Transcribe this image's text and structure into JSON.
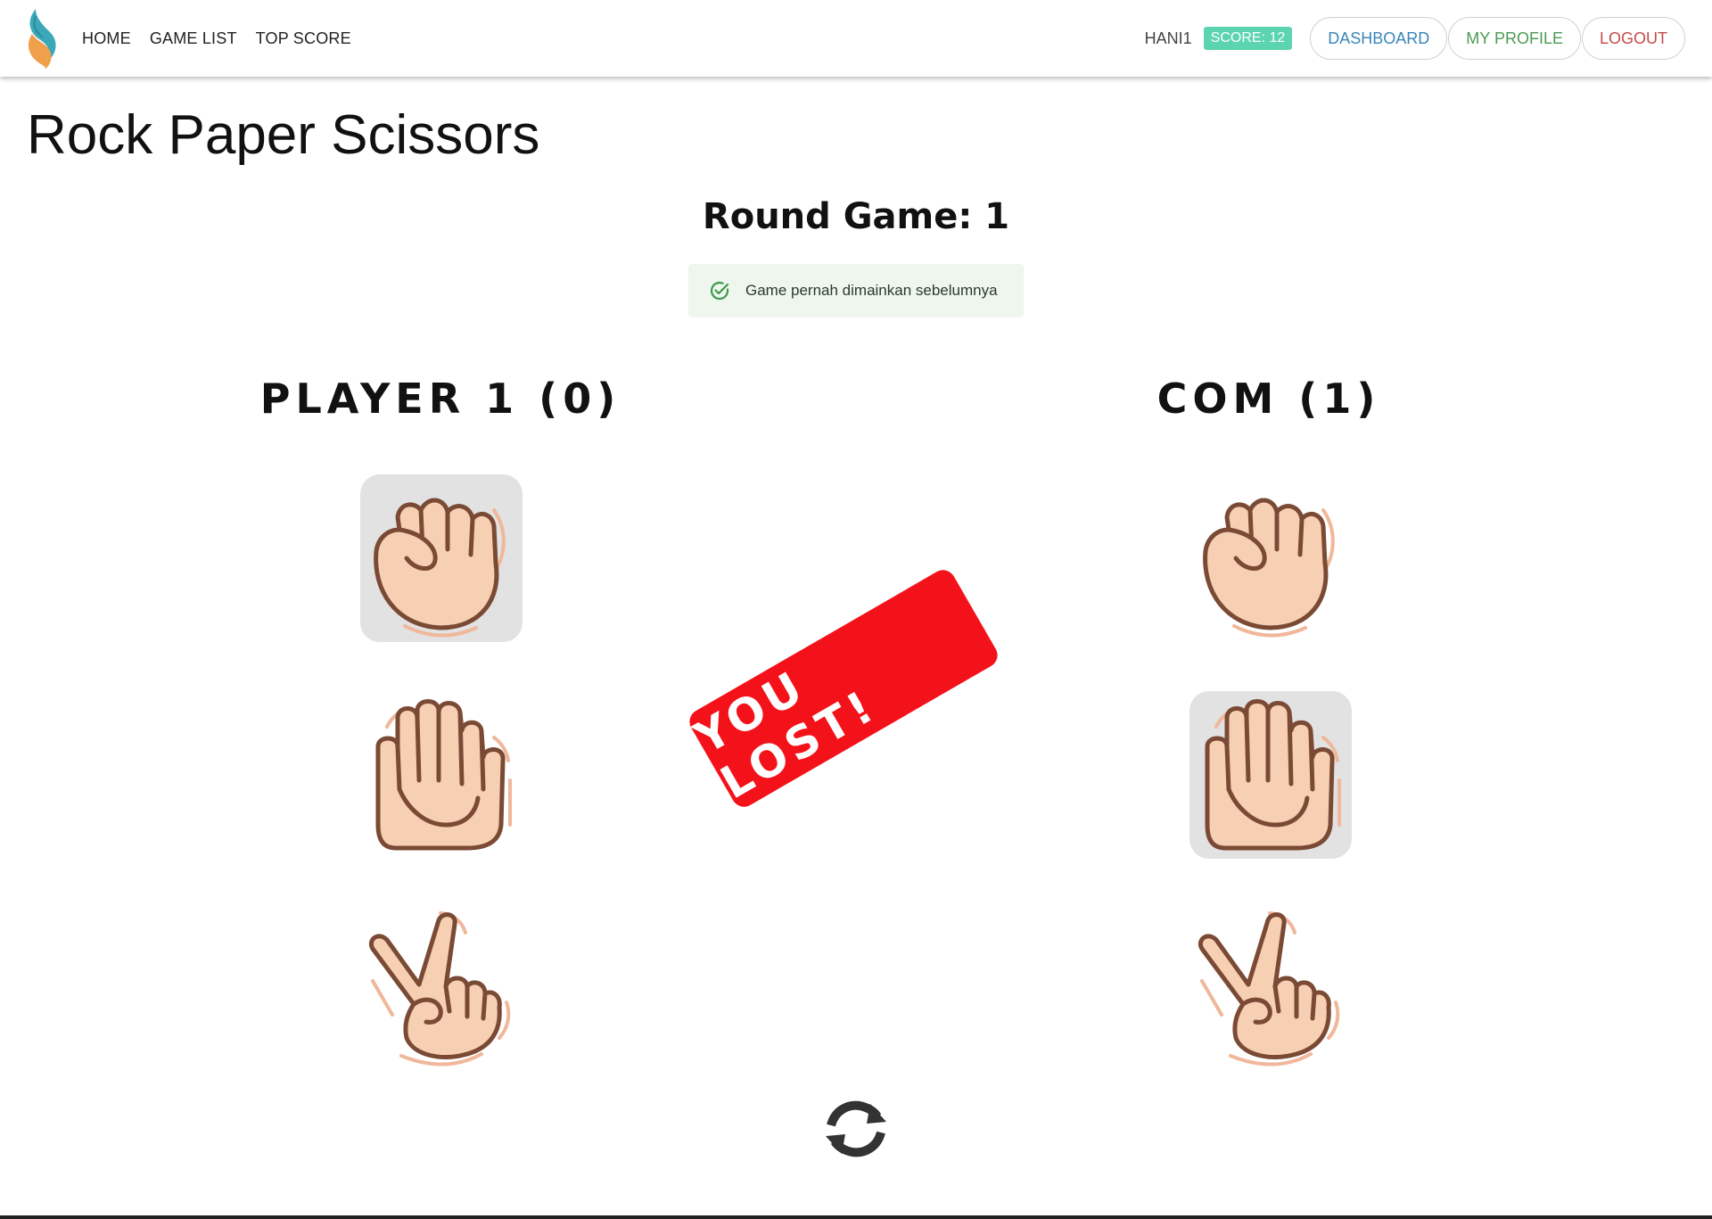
{
  "nav": {
    "links": [
      "HOME",
      "GAME LIST",
      "TOP SCORE"
    ],
    "username": "HANI1",
    "score_badge": "SCORE: 12",
    "buttons": {
      "dashboard": "DASHBOARD",
      "profile": "MY PROFILE",
      "logout": "LOGOUT"
    }
  },
  "page": {
    "title": "Rock Paper Scissors",
    "round_label": "Round Game: 1"
  },
  "alert": {
    "text": "Game pernah dimainkan sebelumnya"
  },
  "players": {
    "player1": {
      "name": "PLAYER 1 (0)",
      "selected_choice": "rock"
    },
    "com": {
      "name": "COM (1)",
      "selected_choice": "paper"
    }
  },
  "result": {
    "text": "YOU LOST!",
    "color": "#f4121a"
  },
  "icons": {
    "logo": "brand-logo-icon",
    "alert": "check-circle-icon",
    "refresh": "refresh-icon",
    "choices": [
      "rock-hand-icon",
      "paper-hand-icon",
      "scissors-hand-icon"
    ]
  },
  "colors": {
    "score_badge": "#5cd4b0",
    "dashboard": "#3a86b8",
    "profile": "#4c9a54",
    "logout": "#c94a4a",
    "selected_bg": "#e2e2e2"
  }
}
